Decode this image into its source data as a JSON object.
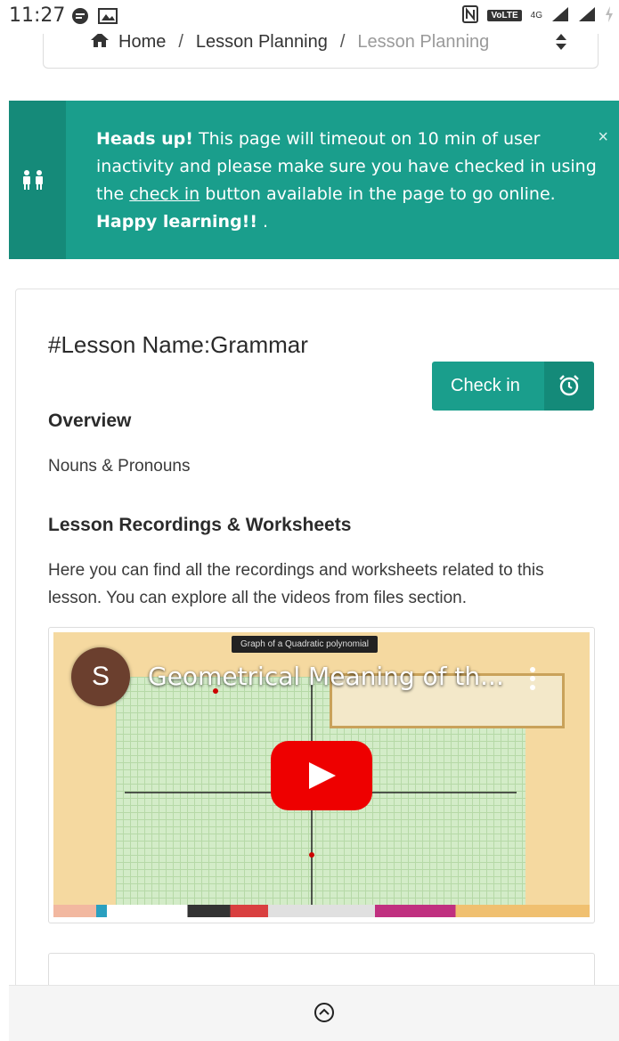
{
  "status_bar": {
    "time": "11:27",
    "network": "4G",
    "volte": "VoLTE"
  },
  "breadcrumb": {
    "home": "Home",
    "separator": "/",
    "level1": "Lesson Planning",
    "current": "Lesson Planning"
  },
  "alert": {
    "bold_lead": "Heads up!",
    "text1": " This page will timeout on 10 min of user inactivity and please make sure you have checked in using the ",
    "link_text": "check in",
    "text2": " button available in the page to go online. ",
    "bold_tail": "Happy learning!!",
    "trailing": " .",
    "close": "×"
  },
  "lesson": {
    "title": "#Lesson Name:Grammar",
    "checkin_label": "Check in",
    "overview_heading": "Overview",
    "overview_text": "Nouns & Pronouns",
    "recordings_heading": "Lesson Recordings & Worksheets",
    "description": "Here you can find all the recordings and worksheets related to this lesson. You can explore all the videos from files section."
  },
  "video": {
    "channel_initial": "S",
    "title": "Geometrical Meaning of th...",
    "overlay_label": "Graph of a Quadratic polynomial"
  },
  "colors": {
    "accent": "#1a9e8c",
    "accent_dark": "#148a79",
    "youtube_red": "#ee0000"
  },
  "icons": {
    "home": "home-icon",
    "sort": "sort-icon",
    "users": "users-icon",
    "alarm": "alarm-clock-icon",
    "play": "play-icon",
    "more": "more-vertical-icon",
    "scroll_top": "chevron-up-circle-icon"
  }
}
